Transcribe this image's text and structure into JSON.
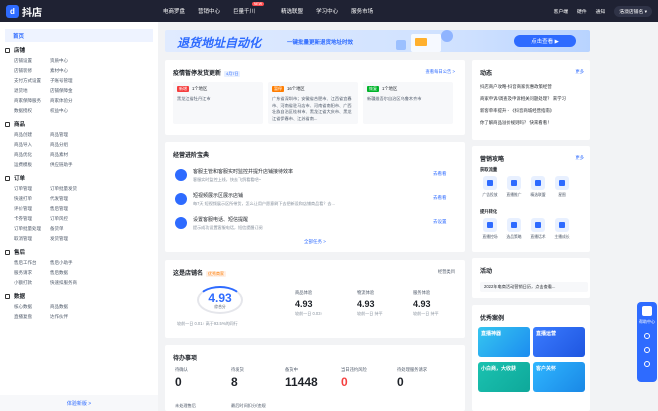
{
  "app": {
    "logo": "抖店",
    "logo_glyph": "d"
  },
  "nav": {
    "items": [
      "电商罗盘",
      "营销中心",
      "巨量千川",
      "精选联盟",
      "学习中心",
      "服务市场"
    ],
    "hot_badge": "NEW"
  },
  "header_right": {
    "service": "客户端",
    "message": "硬件",
    "notify": "通知",
    "account": "浩澳店铺名 ▾"
  },
  "sidebar": {
    "home": "首页",
    "groups": [
      {
        "title": "店铺",
        "items": [
          "店铺设置",
          "资质中心",
          "店铺装修",
          "素材中心",
          "支付方式设置",
          "子账号管理",
          "退货地",
          "店铺保障金",
          "商家保障服务",
          "商家体验分",
          "数据授权",
          "权益中心"
        ]
      },
      {
        "title": "商品",
        "items": [
          "商品创建",
          "商品管理",
          "商品导入",
          "商品分组",
          "商品优化",
          "商品素材",
          "运费模板",
          "供应链助手"
        ]
      },
      {
        "title": "订单",
        "items": [
          "订单管理",
          "订单批量发货",
          "快速打单",
          "代发管理",
          "评价管理",
          "售后管理",
          "卡券管理",
          "订单风控",
          "订单批量处理",
          "备货单",
          "取消管理",
          "发货管理"
        ]
      },
      {
        "title": "售后",
        "items": [
          "售后工作台",
          "售后小助手",
          "服务请求",
          "售后数据",
          "小额打款",
          "快速扣服务商"
        ]
      },
      {
        "title": "数据",
        "items": [
          "核心数据",
          "商品数据",
          "直播复盘",
          "达作伙伴"
        ]
      }
    ],
    "footer": "体验新版 >"
  },
  "banner": {
    "title": "退货地址自动化",
    "subtitle": "一键批量更新退货地址时效",
    "button": "点击查看 ▶"
  },
  "epidemic": {
    "title": "疫情暂停发货更新",
    "date": "4月7日",
    "link": "查看每日公告 >",
    "cards": [
      {
        "tag": "新增",
        "tag_color": "#f53f3f",
        "count": "1个地区",
        "text": "黑龙江省牡丹江市"
      },
      {
        "tag": "暂停",
        "tag_color": "#ff7d00",
        "count": "16个地区",
        "text": "广东省深圳市；安徽省合肥市、江西省宜春市、河南省驻马店市、河南省南阳市、广西壮族自治区桂林市、黑龙江省大庆市、黑龙江省伊春市、江苏省南..."
      },
      {
        "tag": "恢复",
        "tag_color": "#00b42a",
        "count": "1个地区",
        "text": "新疆维吾尔自治区乌鲁木齐市"
      }
    ]
  },
  "guide": {
    "title": "经营进阶宝典",
    "items": [
      {
        "main": "客服主管和客服实时监控并提升店铺接待效率",
        "sub": "客服实时监控上线，快去飞鸽看看吧~",
        "action": "去看看"
      },
      {
        "main": "短视频展示区展示店铺",
        "sub": "每7天 短视频展示区所带货，怎么让用户愿意刷下去把新设和店铺商品看？去...",
        "action": "去看看"
      },
      {
        "main": "设置客服电话、短信提醒",
        "sub": "提示成功设置客服电话，短信提醒订阅",
        "action": "去设置"
      }
    ],
    "all": "全部任务 >"
  },
  "store": {
    "title": "这是店铺名",
    "tag": "优秀商家",
    "link": "经营类目",
    "score": "4.93",
    "score_label": "综合分",
    "rank_text": "较前一日 0.01↑ 高于93.5%的同行",
    "metrics": [
      {
        "label": "商品体验",
        "value": "4.93",
        "sub": "较前一日 0.03↑"
      },
      {
        "label": "物流体验",
        "value": "4.93",
        "sub": "较前一日 持平"
      },
      {
        "label": "服务体验",
        "value": "4.93",
        "sub": "较前一日 持平"
      }
    ]
  },
  "todo": {
    "title": "待办事项",
    "items": [
      {
        "label": "待确认",
        "value": "0"
      },
      {
        "label": "待发货",
        "value": "8"
      },
      {
        "label": "备货中",
        "value": "11448"
      },
      {
        "label": "当日违约风险",
        "value": "0"
      },
      {
        "label": "待处理服务请求",
        "value": "0"
      }
    ],
    "row2": [
      "未处理售后",
      "最后时间扣分/违规"
    ]
  },
  "news": {
    "title": "动态",
    "more": "更多",
    "items": [
      "抖店商户攻略-抖音商家优惠政策经营",
      "商家申诉/调查及申诉相关问题处理？ 来学习",
      "新客单率提升 - 《抖音商城经营指南》",
      "你了解商品溢价规则吗？ 快来看看！"
    ]
  },
  "marketing": {
    "title": "营销攻略",
    "more": "更多",
    "sec1": "获取流量",
    "sec1_items": [
      "广告投放",
      "直播推广",
      "精选联盟",
      "星图"
    ],
    "sec2": "提升转化",
    "sec2_items": [
      "直播控场",
      "选品策略",
      "直播话术",
      "主播成长"
    ]
  },
  "activity": {
    "title": "活动",
    "text": "2022年电商活动营销日历，点击查看..."
  },
  "cases": {
    "title": "优秀案例",
    "items": [
      "直播神器",
      "直播运营",
      "小白商，大收获",
      "客户关怀"
    ]
  },
  "float": {
    "label": "帮助中心"
  }
}
